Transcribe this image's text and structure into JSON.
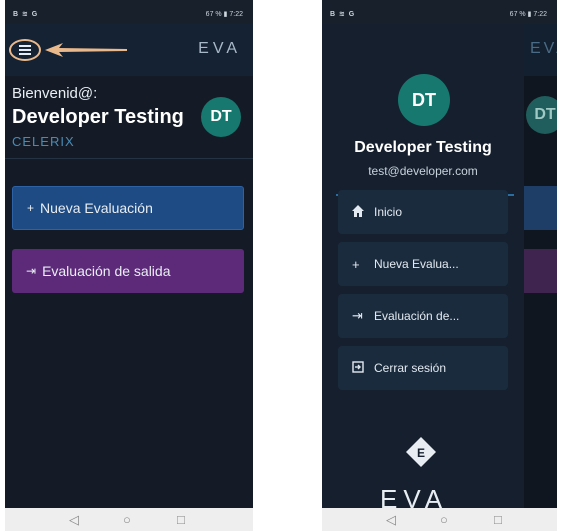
{
  "status_bar": {
    "left_icons": "B ≋ G",
    "battery_time": "67 % ▮ 7:22"
  },
  "app": {
    "logo_text": "EVA"
  },
  "home": {
    "welcome": "Bienvenid@:",
    "user_name": "Developer Testing",
    "company": "CELERIX",
    "avatar_initials": "DT",
    "buttons": [
      {
        "label": "Nueva Evaluación",
        "icon": "plus-icon",
        "color": "#1e4b83"
      },
      {
        "label": "Evaluación de salida",
        "icon": "exit-icon",
        "color": "#5d2a7a"
      }
    ]
  },
  "drawer": {
    "avatar_initials": "DT",
    "user_name": "Developer Testing",
    "email": "test@developer.com",
    "items": [
      {
        "label": "Inicio",
        "icon": "home-icon"
      },
      {
        "label": "Nueva Evalua...",
        "icon": "plus-icon"
      },
      {
        "label": "Evaluación de...",
        "icon": "exit-icon"
      },
      {
        "label": "Cerrar sesión",
        "icon": "logout-icon"
      }
    ],
    "logo_text": "EVA"
  },
  "nav_bar": {
    "back": "◁",
    "home": "○",
    "recent": "□"
  },
  "colors": {
    "background": "#141b26",
    "accent_blue": "#1e4b83",
    "accent_purple": "#5d2a7a",
    "avatar": "#17786f",
    "highlight": "#e9b98c"
  }
}
